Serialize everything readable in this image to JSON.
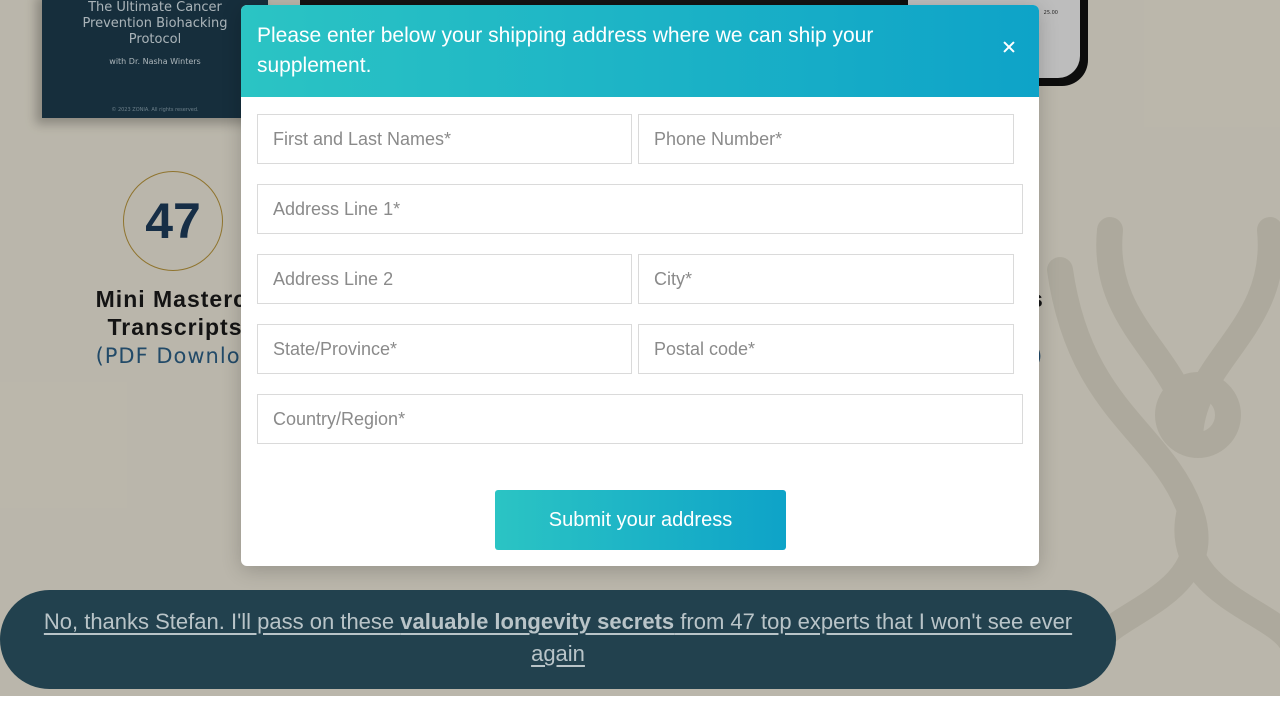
{
  "background": {
    "book": {
      "title_lines": [
        "The Ultimate Cancer",
        "Prevention Biohacking",
        "Protocol"
      ],
      "author": "with Dr. Nasha Winters",
      "copyright": "© 2023 ZONIA. All rights reserved."
    },
    "phone_text": "25.00",
    "feature": {
      "count": "47",
      "title_line1": "Mini Mastercl",
      "title_line2": "Transcripts",
      "subtitle": "(PDF Downloa"
    },
    "right_feature": {
      "title_fragment": "s",
      "subtitle_fragment": ")"
    }
  },
  "modal": {
    "title": "Please enter below your shipping address where we can ship your supplement.",
    "fields": {
      "full_name": {
        "placeholder": "First and Last Names*",
        "value": ""
      },
      "phone": {
        "placeholder": "Phone Number*",
        "value": ""
      },
      "address1": {
        "placeholder": "Address Line 1*",
        "value": ""
      },
      "address2": {
        "placeholder": "Address Line 2",
        "value": ""
      },
      "city": {
        "placeholder": "City*",
        "value": ""
      },
      "state": {
        "placeholder": "State/Province*",
        "value": ""
      },
      "postal": {
        "placeholder": "Postal code*",
        "value": ""
      },
      "country": {
        "placeholder": "Country/Region*",
        "value": ""
      }
    },
    "submit_label": "Submit your address"
  },
  "decline": {
    "text_before": "No, thanks Stefan. I'll pass on these ",
    "text_bold": "valuable longevity secrets",
    "text_after": " from 47 top experts that I won't see ever again"
  },
  "colors": {
    "accent_start": "#2bc4c4",
    "accent_end": "#0ea3c8",
    "decline_bar": "#22414e",
    "page_bg": "#efeadb"
  }
}
